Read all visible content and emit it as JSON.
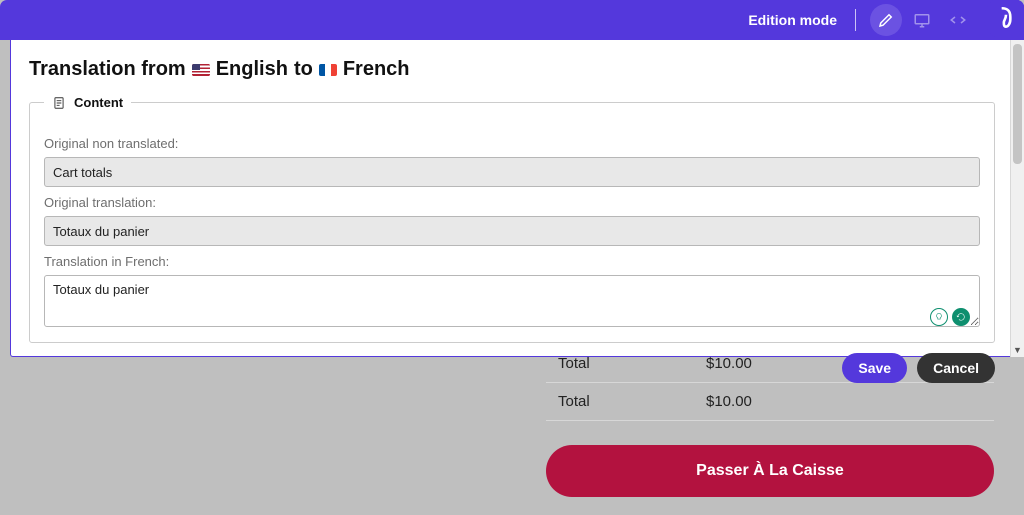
{
  "topbar": {
    "mode_label": "Edition mode"
  },
  "modal": {
    "title_prefix": "Translation from",
    "lang_from": "English",
    "title_to": "to",
    "lang_to": "French",
    "section_label": "Content",
    "label_original_non_translated": "Original non translated:",
    "value_original_non_translated": "Cart totals",
    "label_original_translation": "Original translation:",
    "value_original_translation": "Totaux du panier",
    "label_translation_in": "Translation in French:",
    "value_translation_in": "Totaux du panier",
    "save_label": "Save",
    "cancel_label": "Cancel"
  },
  "cart": {
    "rows": [
      {
        "label": "Total",
        "value": "$10.00"
      },
      {
        "label": "Total",
        "value": "$10.00"
      }
    ],
    "checkout_label": "Passer À La Caisse"
  }
}
